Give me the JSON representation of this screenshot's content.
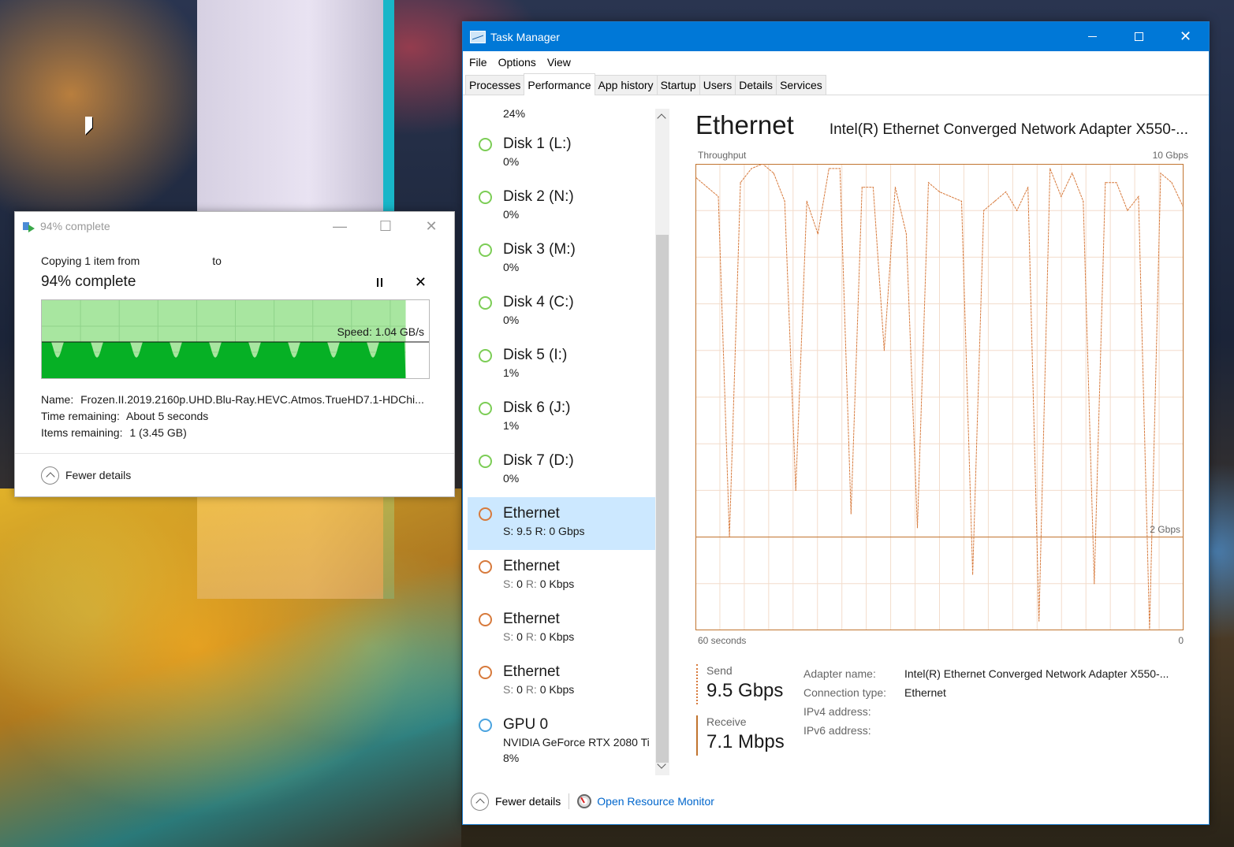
{
  "copy_dialog": {
    "window_title": "94% complete",
    "copying_line": "Copying 1 item from",
    "to_word": "to",
    "percent_heading": "94% complete",
    "speed": "Speed: 1.04 GB/s",
    "progress_percent": 94,
    "name_label": "Name:",
    "name_value": "Frozen.II.2019.2160p.UHD.Blu-Ray.HEVC.Atmos.TrueHD7.1-HDChi...",
    "time_label": "Time remaining:",
    "time_value": "About 5 seconds",
    "items_label": "Items remaining:",
    "items_value": "1 (3.45 GB)",
    "fewer_details": "Fewer details",
    "colors": {
      "progress_fill": "#a8e6a0",
      "graph_fill": "#06b025"
    }
  },
  "task_manager": {
    "window_title": "Task Manager",
    "menu": [
      "File",
      "Options",
      "View"
    ],
    "tabs": [
      "Processes",
      "Performance",
      "App history",
      "Startup",
      "Users",
      "Details",
      "Services"
    ],
    "active_tab": "Performance",
    "resources_top_partial": "24%",
    "resources": [
      {
        "name": "Disk 1 (L:)",
        "sub": "0%",
        "type": "disk"
      },
      {
        "name": "Disk 2 (N:)",
        "sub": "0%",
        "type": "disk"
      },
      {
        "name": "Disk 3 (M:)",
        "sub": "0%",
        "type": "disk"
      },
      {
        "name": "Disk 4 (C:)",
        "sub": "0%",
        "type": "disk"
      },
      {
        "name": "Disk 5 (I:)",
        "sub": "1%",
        "type": "disk"
      },
      {
        "name": "Disk 6 (J:)",
        "sub": "1%",
        "type": "disk"
      },
      {
        "name": "Disk 7 (D:)",
        "sub": "0%",
        "type": "disk"
      },
      {
        "name": "Ethernet",
        "send_label": "S:",
        "send": "9.5",
        "recv_label": "R:",
        "recv": "0 Gbps",
        "type": "net",
        "selected": true
      },
      {
        "name": "Ethernet",
        "send_label": "S:",
        "send": "0",
        "recv_label": "R:",
        "recv": "0 Kbps",
        "type": "net"
      },
      {
        "name": "Ethernet",
        "send_label": "S:",
        "send": "0",
        "recv_label": "R:",
        "recv": "0 Kbps",
        "type": "net"
      },
      {
        "name": "Ethernet",
        "send_label": "S:",
        "send": "0",
        "recv_label": "R:",
        "recv": "0 Kbps",
        "type": "net"
      },
      {
        "name": "GPU 0",
        "sub": "NVIDIA GeForce RTX 2080 Ti",
        "sub2": "8%",
        "type": "gpu"
      }
    ],
    "detail": {
      "title": "Ethernet",
      "adapter_heading": "Intel(R) Ethernet Converged Network Adapter X550-...",
      "throughput_label": "Throughput",
      "max_label": "10 Gbps",
      "mid_label": "2 Gbps",
      "x_left": "60 seconds",
      "x_right": "0",
      "send_label": "Send",
      "send_value": "9.5 Gbps",
      "receive_label": "Receive",
      "receive_value": "7.1 Mbps",
      "properties": [
        {
          "k": "Adapter name:",
          "v": "Intel(R) Ethernet Converged Network Adapter X550-..."
        },
        {
          "k": "Connection type:",
          "v": "Ethernet"
        },
        {
          "k": "IPv4 address:",
          "v": ""
        },
        {
          "k": "IPv6 address:",
          "v": ""
        }
      ]
    },
    "footer": {
      "fewer_details": "Fewer details",
      "open_rm": "Open Resource Monitor"
    },
    "colors": {
      "title_bar": "#0078d7",
      "net_accent": "#d77a3c",
      "disk_accent": "#7ccd56",
      "gpu_accent": "#4aa3df",
      "selected_bg": "#cce8ff"
    }
  },
  "chart_data": {
    "type": "line",
    "title": "Throughput",
    "xlabel": "",
    "ylabel": "",
    "x_range_label": [
      "60 seconds",
      "0"
    ],
    "ylim_gbps": [
      0,
      10
    ],
    "ref_line_gbps": 2,
    "series": [
      {
        "values_gbps": [
          9.7,
          9.5,
          9.3,
          2.0,
          9.6,
          9.9,
          10.0,
          9.8,
          9.2,
          3.0,
          9.2,
          8.5,
          9.9,
          9.9,
          2.5,
          9.5,
          9.5,
          6.0,
          9.5,
          8.5,
          2.2,
          9.6,
          9.4,
          9.3,
          9.2,
          1.2,
          9.0,
          9.2,
          9.4,
          9.0,
          9.5,
          0.2,
          9.9,
          9.3,
          9.8,
          9.2,
          1.0,
          9.6,
          9.6,
          9.0,
          9.3,
          0.0,
          9.8,
          9.6,
          9.1
        ]
      }
    ]
  }
}
